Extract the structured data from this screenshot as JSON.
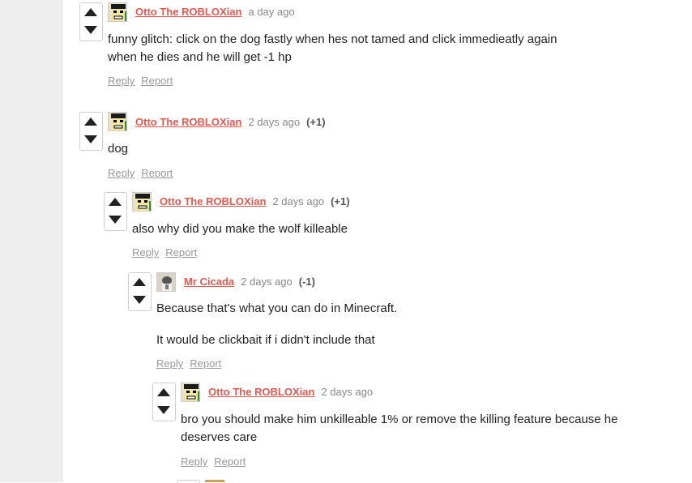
{
  "comments": [
    {
      "author": "Otto The ROBLOXian",
      "time": "a day ago",
      "score": "",
      "text": [
        "funny glitch: click on the dog fastly when hes not tamed and click immedieatly again",
        "when he dies and he will get -1 hp"
      ],
      "avatar": "robloxian-avatar"
    },
    {
      "author": "Otto The ROBLOXian",
      "time": "2 days ago",
      "score": "(+1)",
      "text": [
        "dog"
      ],
      "avatar": "robloxian-avatar"
    },
    {
      "author": "Otto The ROBLOXian",
      "time": "2 days ago",
      "score": "(+1)",
      "text": [
        "also why did you make the wolf killeable"
      ],
      "avatar": "robloxian-avatar"
    },
    {
      "author": "Mr Cicada",
      "time": "2 days ago",
      "score": "(-1)",
      "text": [
        "Because that's what you can do in Minecraft.",
        "It would be clickbait if i didn't include that"
      ],
      "avatar": "cicada-avatar"
    },
    {
      "author": "Otto The ROBLOXian",
      "time": "2 days ago",
      "score": "",
      "text": [
        "bro you should make him unkilleable 1% or remove the killing feature because he",
        "deserves care"
      ],
      "avatar": "robloxian-avatar"
    }
  ],
  "actions": {
    "reply": "Reply",
    "report": "Report"
  },
  "colors": {
    "author": "#e0584f",
    "leftbar": "#eeeeee"
  }
}
